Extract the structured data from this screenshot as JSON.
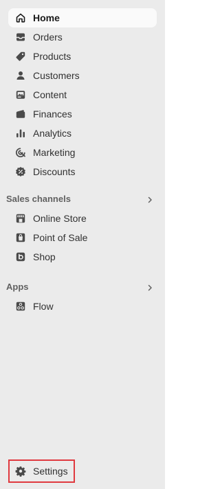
{
  "nav": {
    "home": "Home",
    "orders": "Orders",
    "products": "Products",
    "customers": "Customers",
    "content": "Content",
    "finances": "Finances",
    "analytics": "Analytics",
    "marketing": "Marketing",
    "discounts": "Discounts"
  },
  "sales_channels": {
    "title": "Sales channels",
    "online_store": "Online Store",
    "point_of_sale": "Point of Sale",
    "shop": "Shop"
  },
  "apps": {
    "title": "Apps",
    "flow": "Flow"
  },
  "settings": "Settings",
  "colors": {
    "sidebar_bg": "#ebebeb",
    "active_bg": "#fafafa",
    "text": "#303030",
    "section_text": "#616161",
    "highlight_border": "#e0383e"
  },
  "icons": {
    "home": "home-icon",
    "orders": "inbox-icon",
    "products": "tag-icon",
    "customers": "person-icon",
    "content": "image-icon",
    "finances": "wallet-icon",
    "analytics": "bar-chart-icon",
    "marketing": "target-icon",
    "discounts": "discount-badge-icon",
    "online_store": "storefront-icon",
    "point_of_sale": "pos-bag-icon",
    "shop": "shop-logo-icon",
    "flow": "flow-icon",
    "settings": "gear-icon"
  }
}
